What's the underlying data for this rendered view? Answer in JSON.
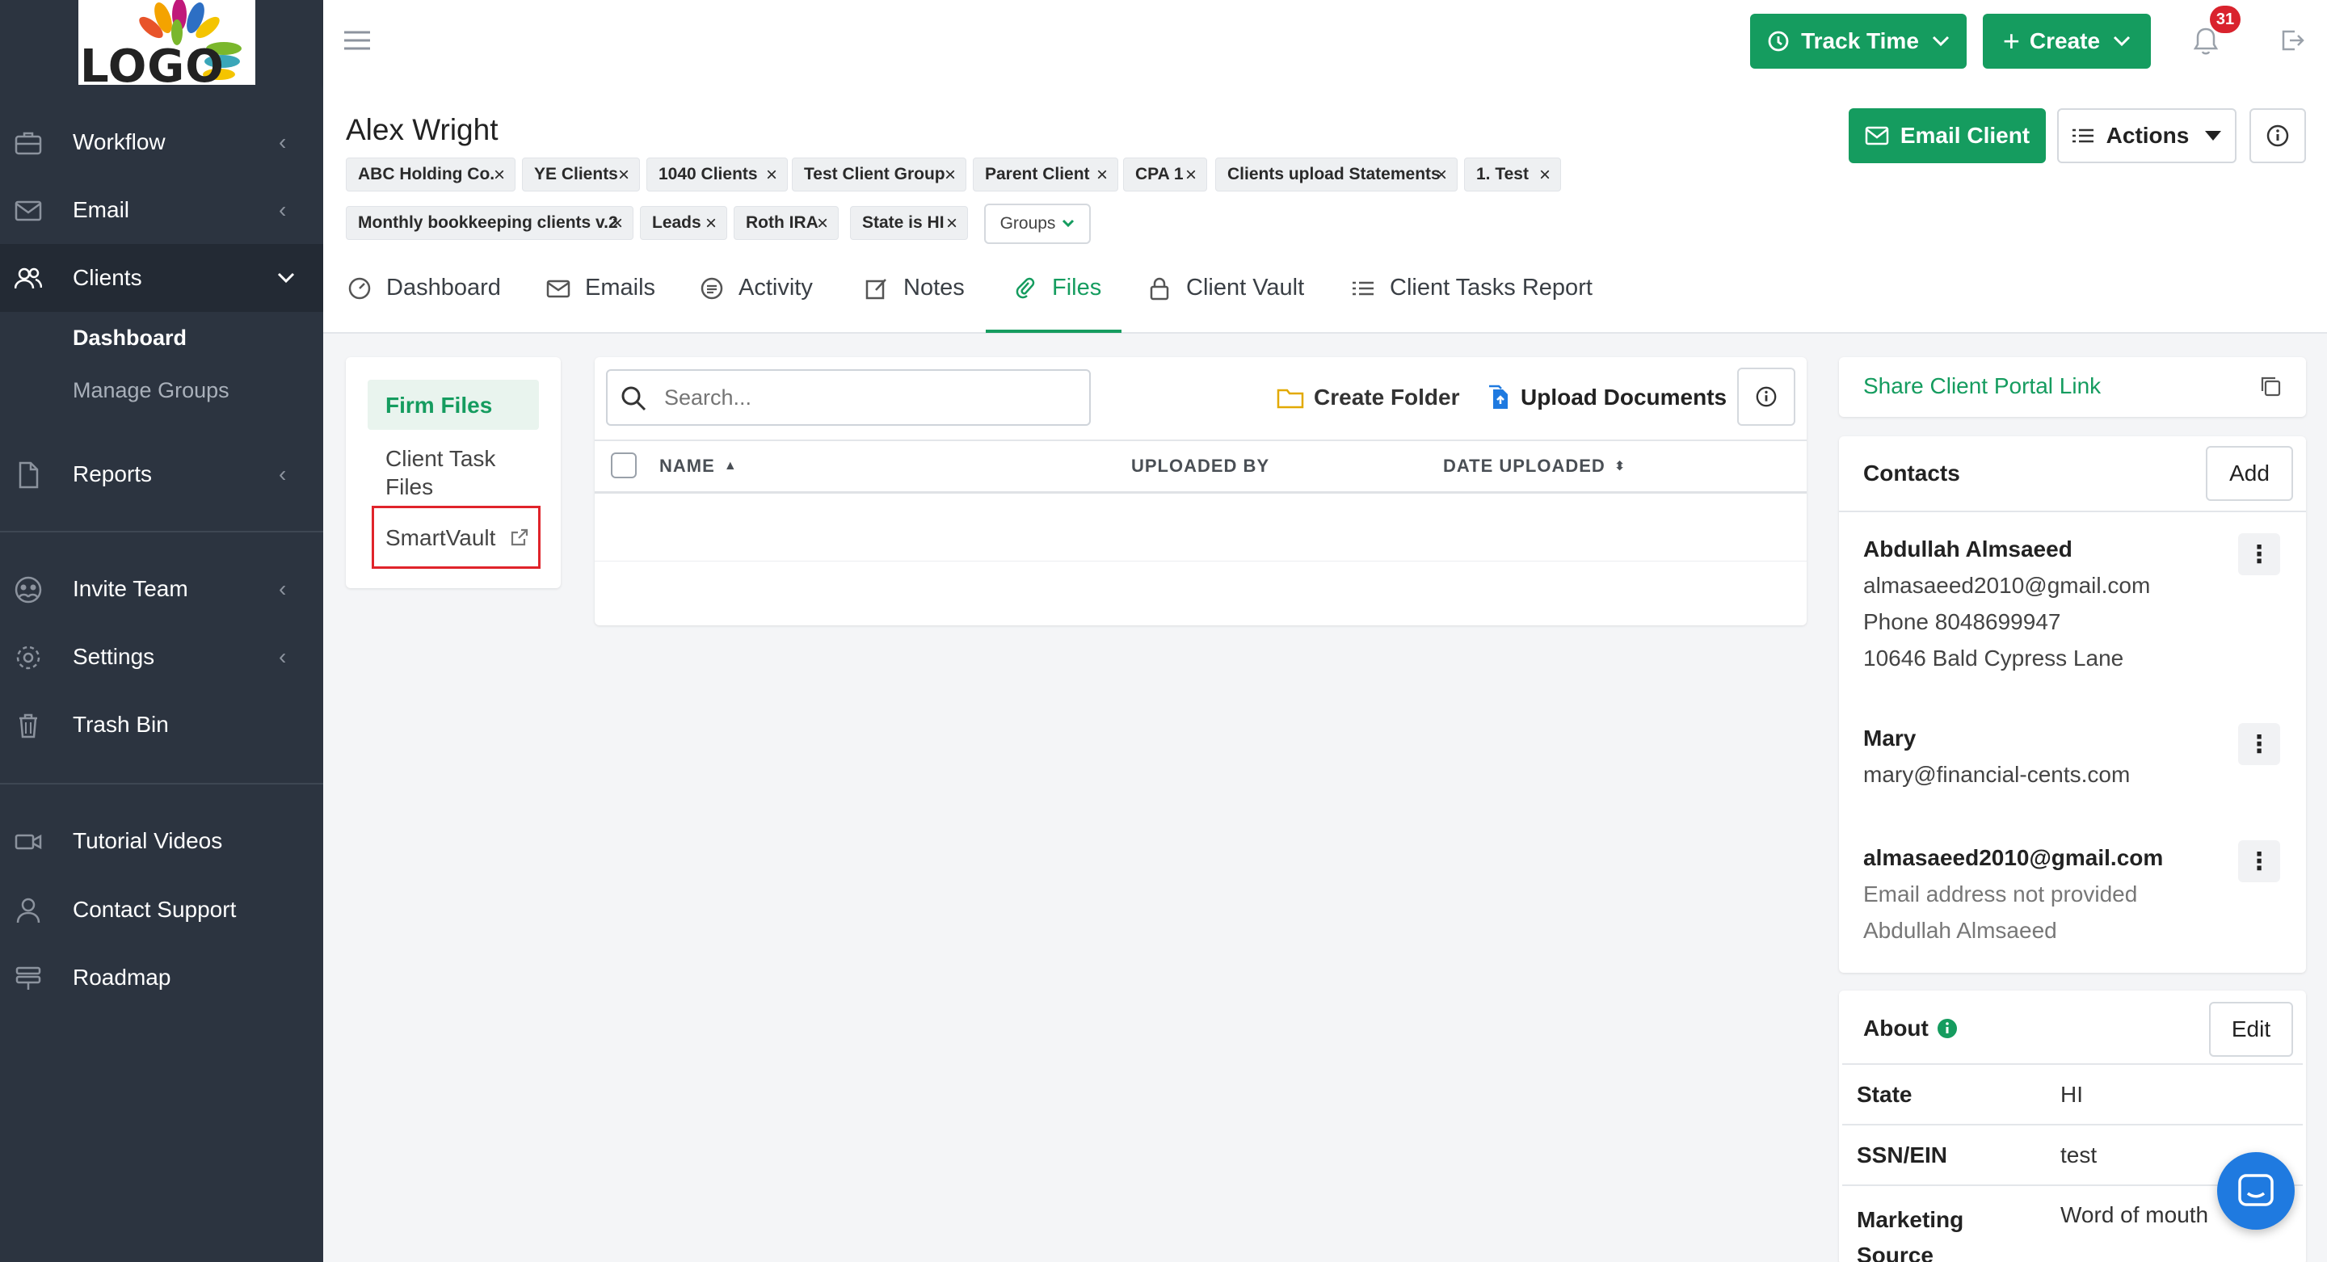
{
  "logo": {
    "text": "LOGO"
  },
  "sidebar": {
    "items": [
      {
        "label": "Workflow",
        "icon": "briefcase-icon"
      },
      {
        "label": "Email",
        "icon": "envelope-icon"
      },
      {
        "label": "Clients",
        "icon": "users-icon"
      },
      {
        "label": "Reports",
        "icon": "document-icon"
      },
      {
        "label": "Invite Team",
        "icon": "team-icon"
      },
      {
        "label": "Settings",
        "icon": "gear-icon"
      },
      {
        "label": "Trash Bin",
        "icon": "trash-icon"
      },
      {
        "label": "Tutorial Videos",
        "icon": "video-icon"
      },
      {
        "label": "Contact Support",
        "icon": "person-icon"
      },
      {
        "label": "Roadmap",
        "icon": "roadmap-icon"
      }
    ],
    "clients_sub": [
      "Dashboard",
      "Manage Groups"
    ]
  },
  "topbar": {
    "track_time": "Track Time",
    "create": "Create",
    "notification_count": "31"
  },
  "client": {
    "name": "Alex Wright",
    "tags_row1": [
      "ABC Holding Co.",
      "YE Clients",
      "1040 Clients",
      "Test Client Group",
      "Parent Client",
      "CPA 1",
      "Clients upload Statements",
      "1. Test"
    ],
    "tags_row2": [
      "Monthly bookkeeping clients v.2",
      "Leads",
      "Roth IRA",
      "State is HI"
    ],
    "groups_button": "Groups",
    "email_client": "Email Client",
    "actions": "Actions"
  },
  "tabs": [
    "Dashboard",
    "Emails",
    "Activity",
    "Notes",
    "Files",
    "Client Vault",
    "Client Tasks Report"
  ],
  "active_tab": "Files",
  "files": {
    "folders": [
      "Firm Files",
      "Client Task Files",
      "SmartVault"
    ],
    "search_placeholder": "Search...",
    "create_folder": "Create Folder",
    "upload_documents": "Upload Documents",
    "columns": [
      "NAME",
      "UPLOADED BY",
      "DATE UPLOADED"
    ]
  },
  "right_panel": {
    "share_link": "Share Client Portal Link",
    "contacts_title": "Contacts",
    "add_button": "Add",
    "contacts": [
      {
        "name": "Abdullah Almsaeed",
        "email": "almasaeed2010@gmail.com",
        "phone": "Phone 8048699947",
        "address": "10646 Bald Cypress Lane"
      },
      {
        "name": "Mary",
        "email": "mary@financial-cents.com"
      },
      {
        "name": "almasaeed2010@gmail.com",
        "line1": "Email address not provided",
        "line2": "Abdullah Almsaeed"
      }
    ],
    "about_title": "About",
    "edit_button": "Edit",
    "about": [
      {
        "label": "State",
        "value": "HI"
      },
      {
        "label": "SSN/EIN",
        "value": "test"
      },
      {
        "label": "Marketing Source",
        "value": "Word of mouth"
      }
    ]
  },
  "colors": {
    "brand_green": "#159c5f",
    "sidebar_bg": "#2c3440",
    "badge_red": "#d9232d",
    "chat_blue": "#1f7ae0"
  }
}
